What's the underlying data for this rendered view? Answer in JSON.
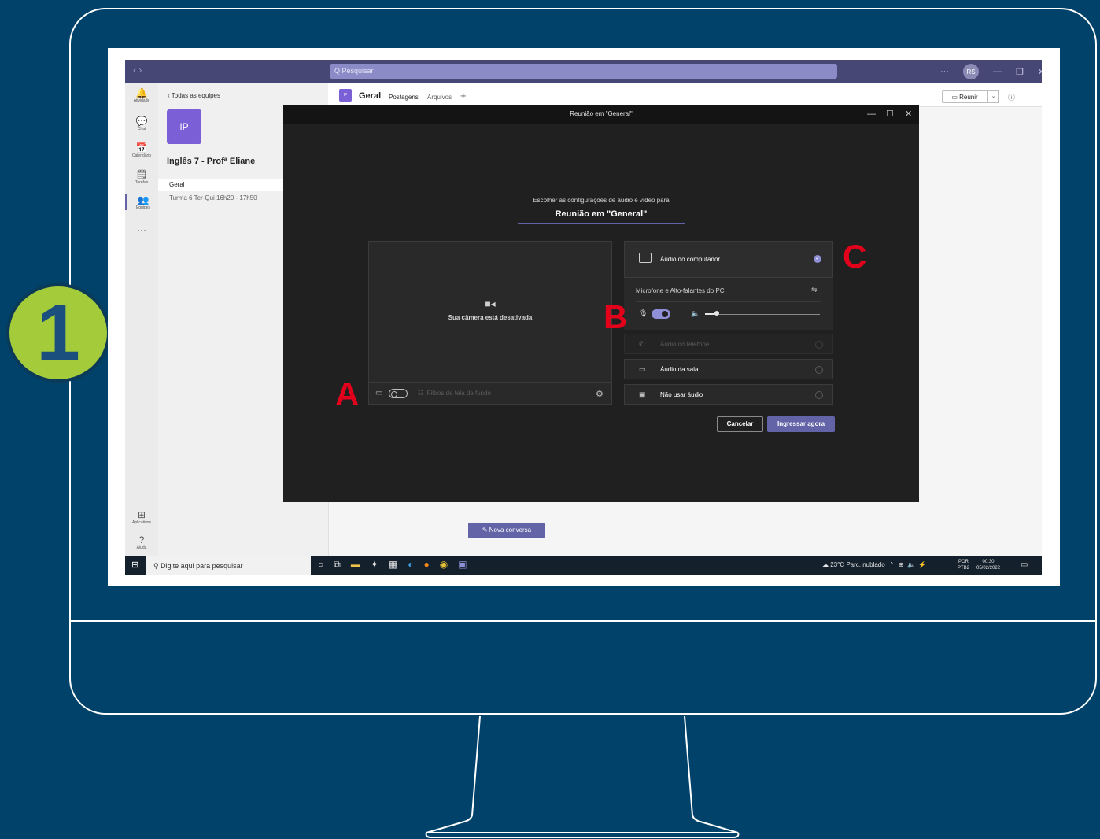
{
  "step_badge": "1",
  "markers": {
    "a": "A",
    "b": "B",
    "c": "C"
  },
  "teams": {
    "nav_arrows": "‹  ›",
    "search_placeholder": "Q  Pesquisar",
    "user_initials": "RS",
    "window_controls": {
      "more": "···",
      "minimize": "—",
      "restore": "❐",
      "close": "✕"
    },
    "rail": [
      {
        "icon": "bell-icon",
        "glyph": "🔔",
        "label": "Atividade"
      },
      {
        "icon": "chat-icon",
        "glyph": "💬",
        "label": "Chat"
      },
      {
        "icon": "calendar-icon",
        "glyph": "📅",
        "label": "Calendário"
      },
      {
        "icon": "tasks-icon",
        "glyph": "🗒",
        "label": "Tarefas"
      },
      {
        "icon": "teams-icon",
        "glyph": "👥",
        "label": "Equipes"
      },
      {
        "icon": "more-icon",
        "glyph": "···",
        "label": ""
      }
    ],
    "rail_bottom": [
      {
        "icon": "apps-icon",
        "glyph": "⊞",
        "label": "Aplicativos"
      },
      {
        "icon": "help-icon",
        "glyph": "?",
        "label": "Ajuda"
      }
    ],
    "back_label": "‹  Todas as equipes",
    "team_initials": "IP",
    "team_name": "Inglês 7 - Profª Eliane",
    "channels": {
      "geral": "Geral",
      "turma": "Turma 6 Ter-Qui 16h20 - 17h50"
    },
    "header": {
      "initials": "IP",
      "channel": "Geral",
      "tab_posts": "Postagens",
      "tab_files": "Arquivos",
      "add": "+",
      "meet_button": "▭ Reunir",
      "meet_dropdown": "⌄",
      "info_more": "ⓘ   ···"
    },
    "new_conversation": "✎  Nova conversa"
  },
  "dialog": {
    "title": "Reunião em \"General\"",
    "subtitle": "Escolher as configurações de áudio e vídeo para",
    "meeting_name": "Reunião em \"General\"",
    "camera_off": "Sua câmera está desativada",
    "background_filters": "Filtros de tela de fundo",
    "audio_computer": "Áudio do computador",
    "mic_speakers": "Microfone e Alto-falantes do PC",
    "audio_phone": "Áudio do telefone",
    "audio_room": "Áudio da sala",
    "no_audio": "Não usar áudio",
    "cancel": "Cancelar",
    "join": "Ingressar agora"
  },
  "taskbar": {
    "search_placeholder": "Digite aqui para pesquisar",
    "weather": "23°C  Parc. nublado",
    "lang1": "POR",
    "lang2": "PTB2",
    "time": "00:30",
    "date": "05/02/2022"
  }
}
